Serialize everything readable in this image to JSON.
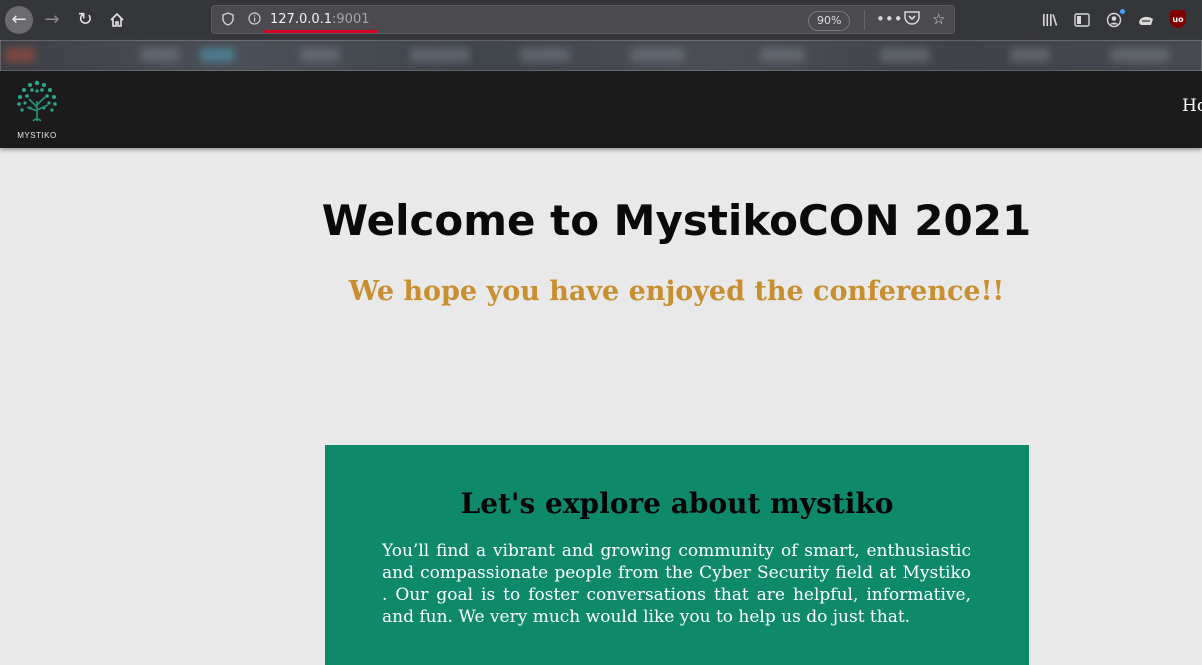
{
  "browser": {
    "url_host": "127.0.0.1",
    "url_port": ":9001",
    "zoom": "90%",
    "icons": {
      "back": "arrow-left-icon",
      "forward": "arrow-right-icon",
      "reload": "reload-icon",
      "home": "home-icon",
      "tracking": "shield-icon",
      "info": "info-icon",
      "page_actions": "more-icon",
      "pocket": "pocket-icon",
      "bookmark": "star-icon",
      "library": "library-icon",
      "sidebar": "sidebar-icon",
      "account": "account-icon",
      "extension": "extension-icon",
      "ublock": "ublock-icon"
    },
    "ublock_label": "uo"
  },
  "site": {
    "logo_text": "MYSTIKO",
    "nav_link": "Ho"
  },
  "main": {
    "title": "Welcome to MystikoCON 2021",
    "subtitle": "We hope you have enjoyed the conference!!",
    "about": {
      "heading": "Let's explore about mystiko",
      "text": "You’ll find a vibrant and growing community of smart, enthusiastic and compassionate people from the Cyber Security field at Mystiko . Our goal is to foster conversations that are helpful, informative, and fun. We very much would like you to help us do just that."
    }
  },
  "colors": {
    "page_bg": "#e9e9e9",
    "nav_bg": "#1b1b1b",
    "subtitle": "#c78f2f",
    "card_bg": "#0e8a6b",
    "url_underline": "#d70022"
  }
}
